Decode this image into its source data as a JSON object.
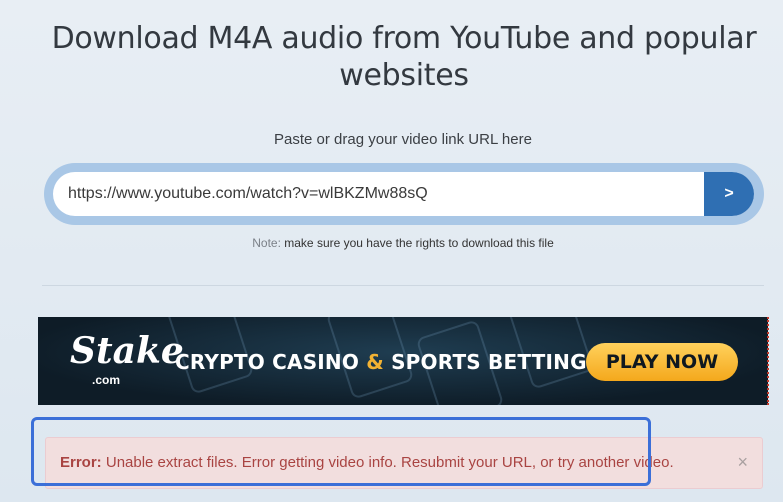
{
  "page": {
    "title": "Download M4A audio from YouTube and popular websites",
    "instruction": "Paste or drag your video link URL here"
  },
  "url_form": {
    "value": "https://www.youtube.com/watch?v=wlBKZMw88sQ",
    "submit_label": ">",
    "button_color": "#2f6fb3"
  },
  "note": {
    "label": "Note:",
    "text": "make sure you have the rights to download this file"
  },
  "ad": {
    "logo": "Stake",
    "logo_sub": ".com",
    "tagline_part1": "CRYPTO CASINO",
    "tagline_amp": "&",
    "tagline_part2": "SPORTS BETTING",
    "cta": "PLAY NOW",
    "cta_color": "#f4a81c"
  },
  "error": {
    "label": "Error:",
    "message": "Unable extract files. Error getting video info. Resubmit your URL, or try another video.",
    "close": "×",
    "background": "#f2dede",
    "text_color": "#a94442"
  },
  "highlight_color": "#3b6fd8"
}
